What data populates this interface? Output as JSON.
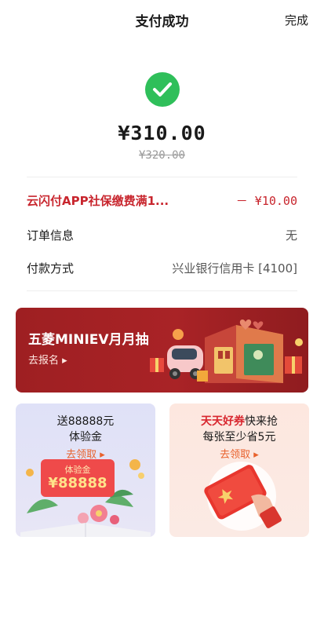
{
  "header": {
    "title": "支付成功",
    "done_label": "完成"
  },
  "payment": {
    "amount": "¥310.00",
    "original_amount": "¥320.00"
  },
  "details": {
    "promo_label": "云闪付APP社保缴费满1...",
    "promo_value": "－ ¥10.00",
    "order_label": "订单信息",
    "order_value": "无",
    "method_label": "付款方式",
    "method_value": "兴业银行信用卡 [4100]"
  },
  "banner": {
    "title": "五菱MINIEV月月抽",
    "cta": "去报名 ▸"
  },
  "cards": {
    "left": {
      "line1": "送88888元",
      "line2": "体验金",
      "cta": "去领取 ▸",
      "tag_label": "体验金",
      "tag_value": "¥88888"
    },
    "right": {
      "line1_highlight": "天天好券",
      "line1_rest": "快来抢",
      "line2": "每张至少省5元",
      "cta": "去领取 ▸"
    }
  },
  "colors": {
    "success_green": "#2fbf5a",
    "promo_red": "#c8262e",
    "banner_red": "#a92326",
    "link_orange": "#e8612c"
  }
}
